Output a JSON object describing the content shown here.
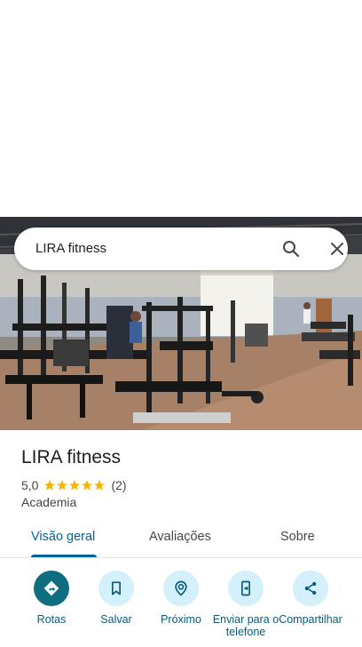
{
  "search": {
    "query": "LIRA fitness"
  },
  "place": {
    "name": "LIRA fitness",
    "rating": "5,0",
    "stars": 5,
    "review_count": "(2)",
    "category": "Academia"
  },
  "tabs": [
    {
      "label": "Visão geral",
      "active": true
    },
    {
      "label": "Avaliações",
      "active": false
    },
    {
      "label": "Sobre",
      "active": false
    }
  ],
  "actions": [
    {
      "label": "Rotas",
      "icon": "directions-icon"
    },
    {
      "label": "Salvar",
      "icon": "bookmark-icon"
    },
    {
      "label": "Próximo",
      "icon": "nearby-icon"
    },
    {
      "label": "Enviar para o telefone",
      "icon": "send-to-phone-icon"
    },
    {
      "label": "Compartilhar",
      "icon": "share-icon"
    }
  ],
  "colors": {
    "accent": "#00639b",
    "primary_action": "#0e6e80",
    "action_bg": "#d3f0fb",
    "star": "#f4b400"
  }
}
